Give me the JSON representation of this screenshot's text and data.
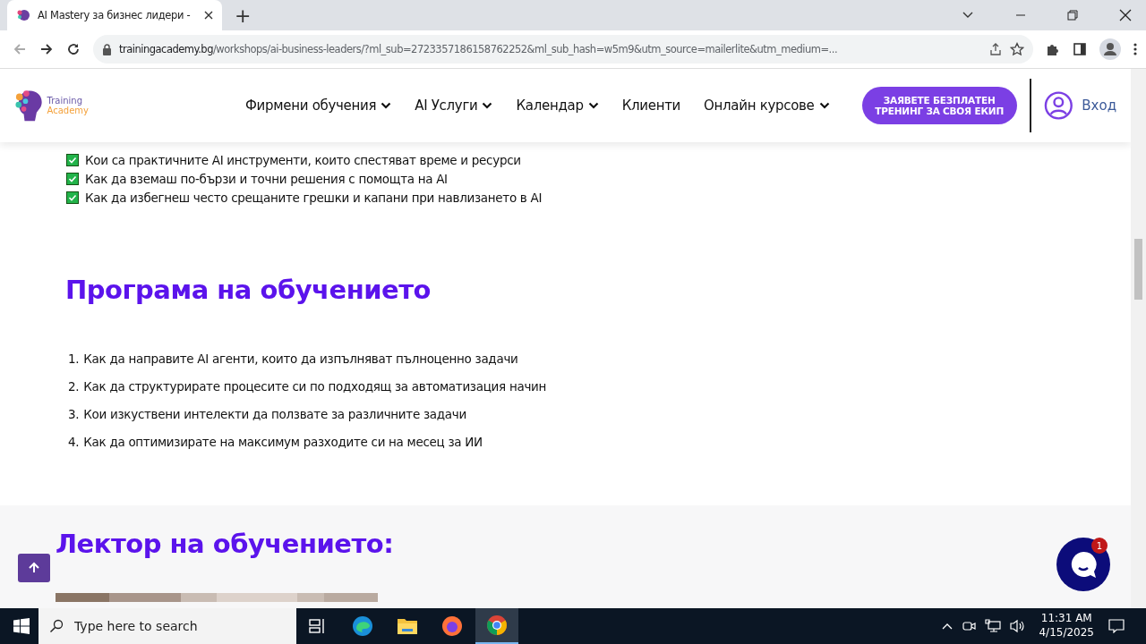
{
  "browser": {
    "tab": {
      "title": "AI Mastery за бизнес лидери -",
      "selected": true
    },
    "new_tab": "+",
    "url": {
      "domain": "trainingacademy.bg",
      "path": "/workshops/ai-business-leaders/?ml_sub=2723357186158762252&ml_sub_hash=w5m9&utm_source=mailerlite&utm_medium=..."
    }
  },
  "site_header": {
    "logo": {
      "word_1": "Training",
      "word_2": "Academy"
    },
    "nav": [
      {
        "label": "Фирмени обучения",
        "dropdown": true
      },
      {
        "label": "AI Услуги",
        "dropdown": true
      },
      {
        "label": "Календар",
        "dropdown": true
      },
      {
        "label": "Клиенти",
        "dropdown": false
      },
      {
        "label": "Онлайн курсове",
        "dropdown": true
      }
    ],
    "cta_button": {
      "line_1": "ЗАЯВЕТЕ БЕЗПЛАТЕН",
      "line_2": "ТРЕНИНГ ЗА СВОЯ ЕКИП"
    },
    "login": "Вход"
  },
  "checklist": [
    {
      "text": "Кои са практичните AI инструменти, които спестяват време и ресурси",
      "checked": true
    },
    {
      "text": "Как да вземаш по-бързи и точни решения с помощта на AI",
      "checked": true
    },
    {
      "text": "Как да избегнеш често срещаните грешки и капани при навлизането в AI",
      "checked": true
    }
  ],
  "program": {
    "heading": "Програма на обучението",
    "items": [
      {
        "number": "1.",
        "text": "Как да направите AI агенти, които да изпълняват пълноценно задачи"
      },
      {
        "number": "2.",
        "text": "Как да структурирате процесите си по подходящ за автоматизация начин"
      },
      {
        "number": "3.",
        "text": "Кои изкуствени интелекти да ползвате за различните задачи"
      },
      {
        "number": "4.",
        "text": "Как да оптимизирате на максимум разходите си на месец за ИИ"
      }
    ]
  },
  "lecturer": {
    "heading": "Лектор на обучението:"
  },
  "chat": {
    "badge": "1"
  },
  "taskbar": {
    "search_placeholder": "Type here to search",
    "apps": [
      {
        "kind": "taskview",
        "selected": false
      },
      {
        "kind": "edge",
        "selected": false
      },
      {
        "kind": "explorer",
        "selected": false
      },
      {
        "kind": "firefox",
        "selected": false
      },
      {
        "kind": "chrome",
        "selected": true
      }
    ],
    "time": "11:31 AM",
    "date": "4/15/2025"
  }
}
